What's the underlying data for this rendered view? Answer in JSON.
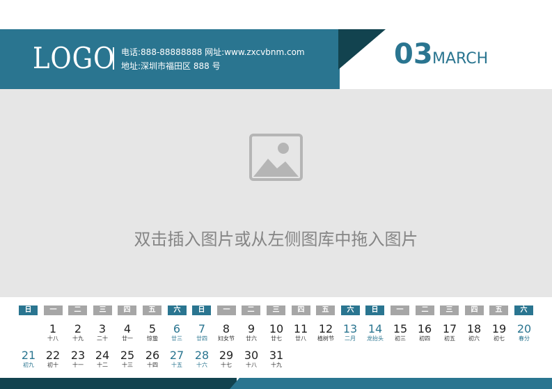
{
  "header": {
    "logo": "LOGO",
    "phone_line": "电话:888-88888888 网址:www.zxcvbnm.com",
    "address_line": "地址:深圳市福田区 888 号",
    "month_number": "03",
    "month_name": "MARCH"
  },
  "photo": {
    "placeholder_text": "双击插入图片或从左侧图库中拖入图片",
    "icon": "image-placeholder-icon"
  },
  "colors": {
    "accent": "#2a7590",
    "dark": "#12434f",
    "weekday_gray": "#a6a6a6",
    "photo_bg": "#e6e6e6"
  },
  "calendar": {
    "weekdays": [
      "日",
      "一",
      "二",
      "三",
      "四",
      "五",
      "六",
      "日",
      "一",
      "二",
      "三",
      "四",
      "五",
      "六",
      "日",
      "一",
      "二",
      "三",
      "四",
      "五",
      "六"
    ],
    "days": [
      {
        "n": "1",
        "l": "十八"
      },
      {
        "n": "2",
        "l": "十九"
      },
      {
        "n": "3",
        "l": "二十"
      },
      {
        "n": "4",
        "l": "廿一"
      },
      {
        "n": "5",
        "l": "惊蛰"
      },
      {
        "n": "6",
        "l": "廿三"
      },
      {
        "n": "7",
        "l": "廿四"
      },
      {
        "n": "8",
        "l": "妇女节"
      },
      {
        "n": "9",
        "l": "廿六"
      },
      {
        "n": "10",
        "l": "廿七"
      },
      {
        "n": "11",
        "l": "廿八"
      },
      {
        "n": "12",
        "l": "植树节"
      },
      {
        "n": "13",
        "l": "二月"
      },
      {
        "n": "14",
        "l": "龙抬头"
      },
      {
        "n": "15",
        "l": "初三"
      },
      {
        "n": "16",
        "l": "初四"
      },
      {
        "n": "17",
        "l": "初五"
      },
      {
        "n": "18",
        "l": "初六"
      },
      {
        "n": "19",
        "l": "初七"
      },
      {
        "n": "20",
        "l": "春分"
      },
      {
        "n": "21",
        "l": "初九"
      },
      {
        "n": "22",
        "l": "初十"
      },
      {
        "n": "23",
        "l": "十一"
      },
      {
        "n": "24",
        "l": "十二"
      },
      {
        "n": "25",
        "l": "十三"
      },
      {
        "n": "26",
        "l": "十四"
      },
      {
        "n": "27",
        "l": "十五"
      },
      {
        "n": "28",
        "l": "十六"
      },
      {
        "n": "29",
        "l": "十七"
      },
      {
        "n": "30",
        "l": "十八"
      },
      {
        "n": "31",
        "l": "十九"
      }
    ]
  }
}
